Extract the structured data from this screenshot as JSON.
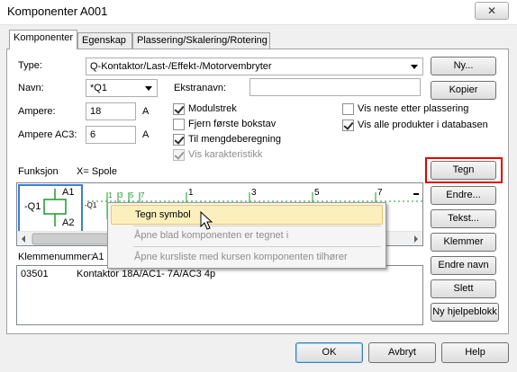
{
  "window": {
    "title": "Komponenter  A001",
    "close_label": "✕"
  },
  "tabs": [
    {
      "label": "Komponenter",
      "active": true
    },
    {
      "label": "Egenskap",
      "active": false
    },
    {
      "label": "Plassering/Skalering/Rotering",
      "active": false
    }
  ],
  "form": {
    "type_label": "Type:",
    "type_value": "Q-Kontaktor/Last-/Effekt-/Motorvembryter",
    "navn_label": "Navn:",
    "navn_value": "*Q1",
    "ekstranavn_label": "Ekstranavn:",
    "ekstranavn_value": "",
    "ampere_label": "Ampere:",
    "ampere_value": "18",
    "ampere_unit": "A",
    "ampere_ac3_label": "Ampere AC3:",
    "ampere_ac3_value": "6",
    "ampere_ac3_unit": "A"
  },
  "checkboxes": {
    "modulstrek": {
      "label": "Modulstrek",
      "checked": true
    },
    "fjern": {
      "label": "Fjern første bokstav",
      "checked": false
    },
    "til_mengde": {
      "label": "Til mengdeberegning",
      "checked": true
    },
    "vis_kar": {
      "label": "Vis karakteristikk",
      "checked": true,
      "disabled": true
    },
    "vis_neste": {
      "label": "Vis neste etter plassering",
      "checked": false
    },
    "vis_alle": {
      "label": "Vis alle produkter i databasen",
      "checked": true
    }
  },
  "funksjon": {
    "label": "Funksjon",
    "value": "X= Spole"
  },
  "symbol": {
    "name": "-Q1",
    "a1": "A1",
    "a2": "A2",
    "small_name": "-Q1",
    "contacts": [
      "1",
      "3",
      "5",
      "7",
      "1",
      "3",
      "5",
      "7"
    ]
  },
  "klemmenummer": {
    "label": "Klemmenummer:",
    "value": "A1"
  },
  "term_row": {
    "nr": "03501",
    "text": "Kontaktor  18A/AC1-  7A/AC3   4p"
  },
  "context_menu": [
    {
      "label": "Tegn symbol",
      "enabled": true
    },
    {
      "label": "Åpne blad komponenten er tegnet i",
      "enabled": false
    },
    {
      "label": "Åpne kursliste med kursen komponenten tilhører",
      "enabled": false
    }
  ],
  "side_buttons": {
    "ny": "Ny...",
    "kopier": "Kopier",
    "tegn": "Tegn",
    "endre": "Endre...",
    "tekst": "Tekst...",
    "klemmer": "Klemmer",
    "endre_navn": "Endre navn",
    "slett": "Slett",
    "ny_hjelpeblokk": "Ny hjelpeblokk"
  },
  "footer": {
    "ok": "OK",
    "avbryt": "Avbryt",
    "help": "Help"
  }
}
